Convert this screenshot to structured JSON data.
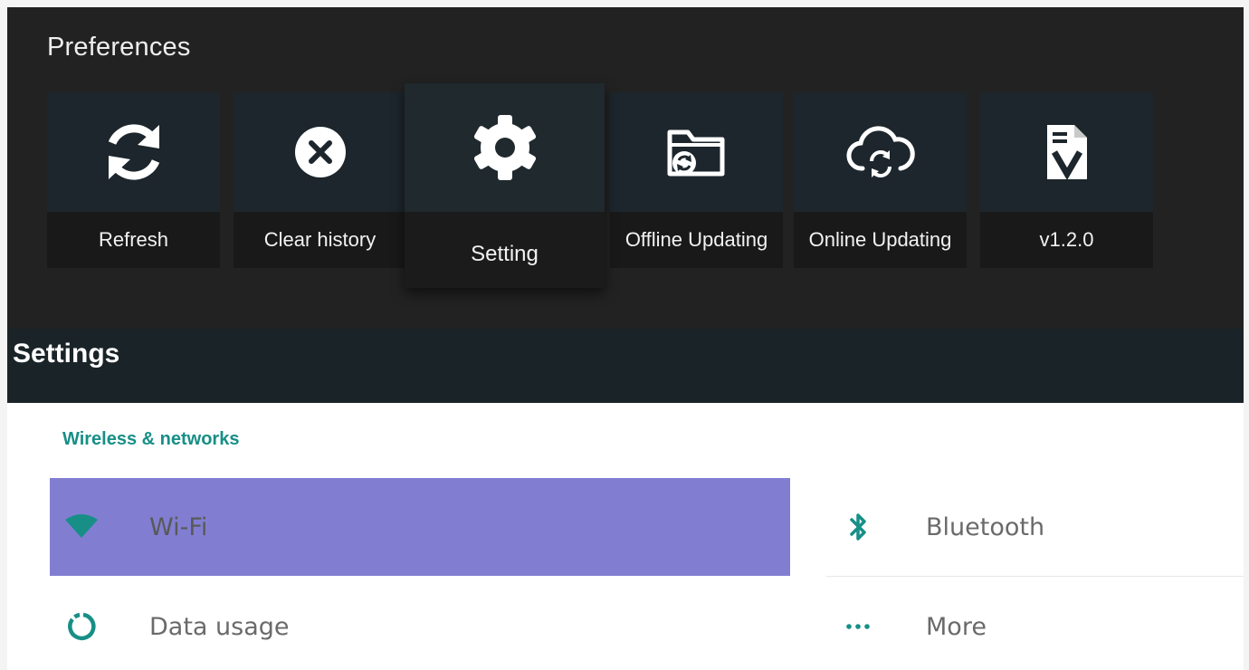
{
  "preferences": {
    "title": "Preferences",
    "tiles": [
      {
        "label": "Refresh",
        "icon": "refresh-icon"
      },
      {
        "label": "Clear history",
        "icon": "close-circle-icon"
      },
      {
        "label": "Setting",
        "icon": "gear-icon",
        "focused": true
      },
      {
        "label": "Offline Updating",
        "icon": "folder-sync-icon"
      },
      {
        "label": "Online Updating",
        "icon": "cloud-sync-icon"
      },
      {
        "label": "v1.2.0",
        "icon": "version-file-icon"
      }
    ]
  },
  "settings": {
    "title": "Settings",
    "section": "Wireless & networks",
    "items": [
      {
        "label": "Wi-Fi",
        "icon": "wifi-icon",
        "selected": true
      },
      {
        "label": "Bluetooth",
        "icon": "bluetooth-icon"
      },
      {
        "label": "Data usage",
        "icon": "data-usage-icon"
      },
      {
        "label": "More",
        "icon": "more-dots-icon"
      }
    ]
  },
  "colors": {
    "accent": "#178f87",
    "selected": "#817ed2",
    "dark_panel": "#222222",
    "settings_bar": "#1a2428"
  }
}
